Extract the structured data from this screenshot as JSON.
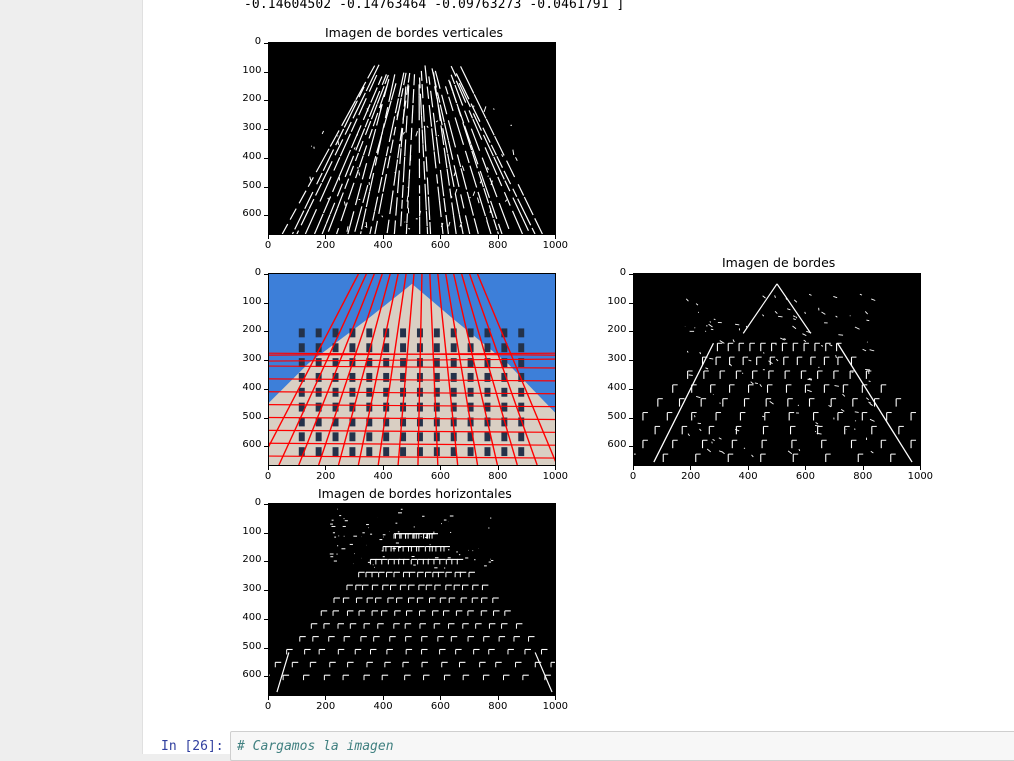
{
  "output": {
    "array_text": "-0.14604502 -0.14763464 -0.09763273 -0.0461791 ]"
  },
  "plots": {
    "vertical": {
      "title": "Imagen de bordes verticales"
    },
    "lines": {
      "title": ""
    },
    "edges": {
      "title": "Imagen de bordes"
    },
    "horizontal": {
      "title": "Imagen de bordes horizontales"
    }
  },
  "axes": {
    "x_ticks": [
      "0",
      "200",
      "400",
      "600",
      "800",
      "1000"
    ],
    "y_ticks": [
      "0",
      "100",
      "200",
      "300",
      "400",
      "500",
      "600"
    ]
  },
  "cell": {
    "prompt": "In [26]:",
    "code": "# Cargamos la imagen"
  },
  "colors": {
    "prompt": "#303f9f",
    "comment": "#408080",
    "hough_lines": "#ff0000",
    "sky": "#3d7fd9"
  }
}
